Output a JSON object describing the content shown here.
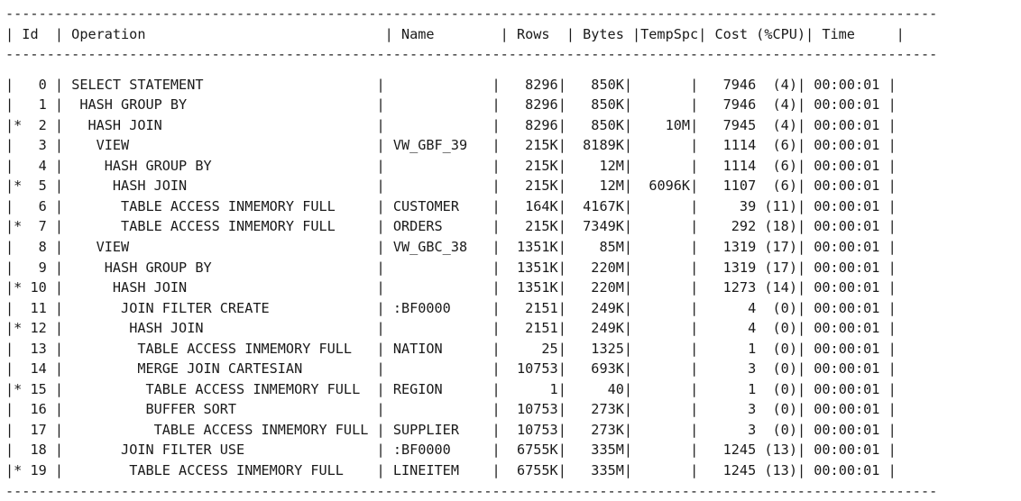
{
  "plan": {
    "separator": "-----------------------------------------------------------------------------------------------------------------",
    "columns": [
      "Id",
      "Operation",
      "Name",
      "Rows",
      "Bytes",
      "TempSpc",
      "Cost (%CPU)",
      "Time"
    ],
    "rows": [
      {
        "pred": "",
        "id": "0",
        "operation": "SELECT STATEMENT",
        "name": "",
        "rows": "8296",
        "bytes": "850K",
        "tempspc": "",
        "cost": "7946",
        "cpu": "(4)",
        "time": "00:00:01"
      },
      {
        "pred": "",
        "id": "1",
        "operation": " HASH GROUP BY",
        "name": "",
        "rows": "8296",
        "bytes": "850K",
        "tempspc": "",
        "cost": "7946",
        "cpu": "(4)",
        "time": "00:00:01"
      },
      {
        "pred": "*",
        "id": "2",
        "operation": "  HASH JOIN",
        "name": "",
        "rows": "8296",
        "bytes": "850K",
        "tempspc": "10M",
        "cost": "7945",
        "cpu": "(4)",
        "time": "00:00:01"
      },
      {
        "pred": "",
        "id": "3",
        "operation": "   VIEW",
        "name": "VW_GBF_39",
        "rows": "215K",
        "bytes": "8189K",
        "tempspc": "",
        "cost": "1114",
        "cpu": "(6)",
        "time": "00:00:01"
      },
      {
        "pred": "",
        "id": "4",
        "operation": "    HASH GROUP BY",
        "name": "",
        "rows": "215K",
        "bytes": "12M",
        "tempspc": "",
        "cost": "1114",
        "cpu": "(6)",
        "time": "00:00:01"
      },
      {
        "pred": "*",
        "id": "5",
        "operation": "     HASH JOIN",
        "name": "",
        "rows": "215K",
        "bytes": "12M",
        "tempspc": "6096K",
        "cost": "1107",
        "cpu": "(6)",
        "time": "00:00:01"
      },
      {
        "pred": "",
        "id": "6",
        "operation": "      TABLE ACCESS INMEMORY FULL",
        "name": "CUSTOMER",
        "rows": "164K",
        "bytes": "4167K",
        "tempspc": "",
        "cost": "39",
        "cpu": "(11)",
        "time": "00:00:01"
      },
      {
        "pred": "*",
        "id": "7",
        "operation": "      TABLE ACCESS INMEMORY FULL",
        "name": "ORDERS",
        "rows": "215K",
        "bytes": "7349K",
        "tempspc": "",
        "cost": "292",
        "cpu": "(18)",
        "time": "00:00:01"
      },
      {
        "pred": "",
        "id": "8",
        "operation": "   VIEW",
        "name": "VW_GBC_38",
        "rows": "1351K",
        "bytes": "85M",
        "tempspc": "",
        "cost": "1319",
        "cpu": "(17)",
        "time": "00:00:01"
      },
      {
        "pred": "",
        "id": "9",
        "operation": "    HASH GROUP BY",
        "name": "",
        "rows": "1351K",
        "bytes": "220M",
        "tempspc": "",
        "cost": "1319",
        "cpu": "(17)",
        "time": "00:00:01"
      },
      {
        "pred": "*",
        "id": "10",
        "operation": "     HASH JOIN",
        "name": "",
        "rows": "1351K",
        "bytes": "220M",
        "tempspc": "",
        "cost": "1273",
        "cpu": "(14)",
        "time": "00:00:01"
      },
      {
        "pred": "",
        "id": "11",
        "operation": "      JOIN FILTER CREATE",
        "name": ":BF0000",
        "rows": "2151",
        "bytes": "249K",
        "tempspc": "",
        "cost": "4",
        "cpu": "(0)",
        "time": "00:00:01"
      },
      {
        "pred": "*",
        "id": "12",
        "operation": "       HASH JOIN",
        "name": "",
        "rows": "2151",
        "bytes": "249K",
        "tempspc": "",
        "cost": "4",
        "cpu": "(0)",
        "time": "00:00:01"
      },
      {
        "pred": "",
        "id": "13",
        "operation": "        TABLE ACCESS INMEMORY FULL",
        "name": "NATION",
        "rows": "25",
        "bytes": "1325",
        "tempspc": "",
        "cost": "1",
        "cpu": "(0)",
        "time": "00:00:01"
      },
      {
        "pred": "",
        "id": "14",
        "operation": "        MERGE JOIN CARTESIAN",
        "name": "",
        "rows": "10753",
        "bytes": "693K",
        "tempspc": "",
        "cost": "3",
        "cpu": "(0)",
        "time": "00:00:01"
      },
      {
        "pred": "*",
        "id": "15",
        "operation": "         TABLE ACCESS INMEMORY FULL",
        "name": "REGION",
        "rows": "1",
        "bytes": "40",
        "tempspc": "",
        "cost": "1",
        "cpu": "(0)",
        "time": "00:00:01"
      },
      {
        "pred": "",
        "id": "16",
        "operation": "         BUFFER SORT",
        "name": "",
        "rows": "10753",
        "bytes": "273K",
        "tempspc": "",
        "cost": "3",
        "cpu": "(0)",
        "time": "00:00:01"
      },
      {
        "pred": "",
        "id": "17",
        "operation": "          TABLE ACCESS INMEMORY FULL",
        "name": "SUPPLIER",
        "rows": "10753",
        "bytes": "273K",
        "tempspc": "",
        "cost": "3",
        "cpu": "(0)",
        "time": "00:00:01"
      },
      {
        "pred": "",
        "id": "18",
        "operation": "      JOIN FILTER USE",
        "name": ":BF0000",
        "rows": "6755K",
        "bytes": "335M",
        "tempspc": "",
        "cost": "1245",
        "cpu": "(13)",
        "time": "00:00:01"
      },
      {
        "pred": "*",
        "id": "19",
        "operation": "       TABLE ACCESS INMEMORY FULL",
        "name": "LINEITEM",
        "rows": "6755K",
        "bytes": "335M",
        "tempspc": "",
        "cost": "1245",
        "cpu": "(13)",
        "time": "00:00:01"
      }
    ]
  }
}
